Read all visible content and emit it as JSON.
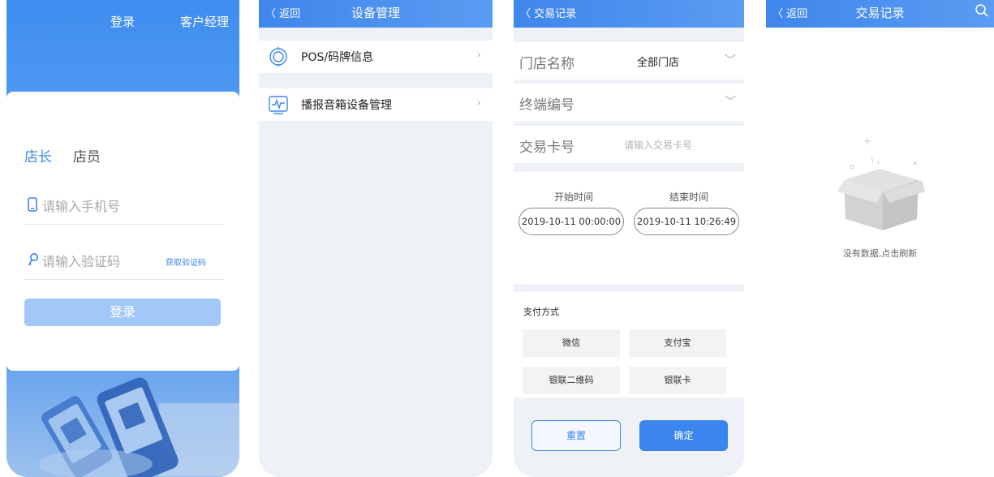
{
  "screen1": {
    "links": {
      "login": "登录",
      "manager": "客户经理"
    },
    "roles": {
      "owner": "店长",
      "staff": "店员"
    },
    "phone_placeholder": "请输入手机号",
    "code_placeholder": "请输入验证码",
    "get_code": "获取验证码",
    "login_button": "登录"
  },
  "screen2": {
    "back": "返回",
    "title": "设备管理",
    "items": [
      {
        "label": "POS/码牌信息"
      },
      {
        "label": "播报音箱设备管理"
      }
    ]
  },
  "screen3": {
    "back": "交易记录",
    "store_label": "门店名称",
    "store_value": "全部门店",
    "terminal_label": "终端编号",
    "card_label": "交易卡号",
    "card_placeholder": "请输入交易卡号",
    "start_label": "开始时间",
    "end_label": "结束时间",
    "start_value": "2019-10-11 00:00:00",
    "end_value": "2019-10-11 10:26:49",
    "pay_title": "支付方式",
    "pay_methods": [
      "微信",
      "支付宝",
      "银联二维码",
      "银联卡"
    ],
    "reset": "重置",
    "confirm": "确定"
  },
  "screen4": {
    "back": "返回",
    "title": "交易记录",
    "empty_text": "没有数据,点击刷新"
  },
  "colors": {
    "primary": "#3a86ee",
    "nav_start": "#3f86ec",
    "background": "#eef2f6"
  }
}
